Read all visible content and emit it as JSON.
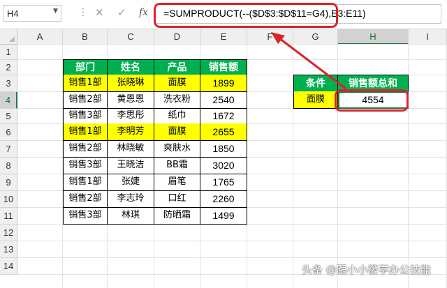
{
  "formula_bar": {
    "name_box": "H4",
    "formula": "=SUMPRODUCT(--($D$3:$D$11=G4),E3:E11)",
    "cancel_icon": "cancel-x-icon",
    "enter_icon": "enter-check-icon",
    "function_icon": "fx-icon"
  },
  "columns": [
    "A",
    "B",
    "C",
    "D",
    "E",
    "F",
    "G",
    "H",
    "I"
  ],
  "rows": [
    "1",
    "2",
    "3",
    "4",
    "5",
    "6",
    "7",
    "8",
    "9",
    "10",
    "11",
    "12",
    "13",
    "14"
  ],
  "table": {
    "headers": [
      "部门",
      "姓名",
      "产品",
      "销售额"
    ],
    "rows": [
      [
        "销售1部",
        "张晓琳",
        "面膜",
        "1899"
      ],
      [
        "销售2部",
        "黄恩恩",
        "洗衣粉",
        "2540"
      ],
      [
        "销售3部",
        "李思彤",
        "纸巾",
        "1672"
      ],
      [
        "销售1部",
        "李明芳",
        "面膜",
        "2655"
      ],
      [
        "销售2部",
        "林晓敏",
        "爽肤水",
        "1850"
      ],
      [
        "销售3部",
        "王晓洁",
        "BB霜",
        "3020"
      ],
      [
        "销售1部",
        "张婕",
        "眉笔",
        "1765"
      ],
      [
        "销售2部",
        "李志玲",
        "口红",
        "2260"
      ],
      [
        "销售3部",
        "林琪",
        "防晒霜",
        "1499"
      ]
    ]
  },
  "criteria": {
    "headers": [
      "条件",
      "销售额总和"
    ],
    "condition": "面膜",
    "result": "4554"
  },
  "colors": {
    "header_green": "#00b050",
    "highlight_yellow": "#ffff00",
    "callout_red": "#d9242a",
    "excel_green": "#217346"
  },
  "watermark": "头条 @跟小小筱学办公技能"
}
